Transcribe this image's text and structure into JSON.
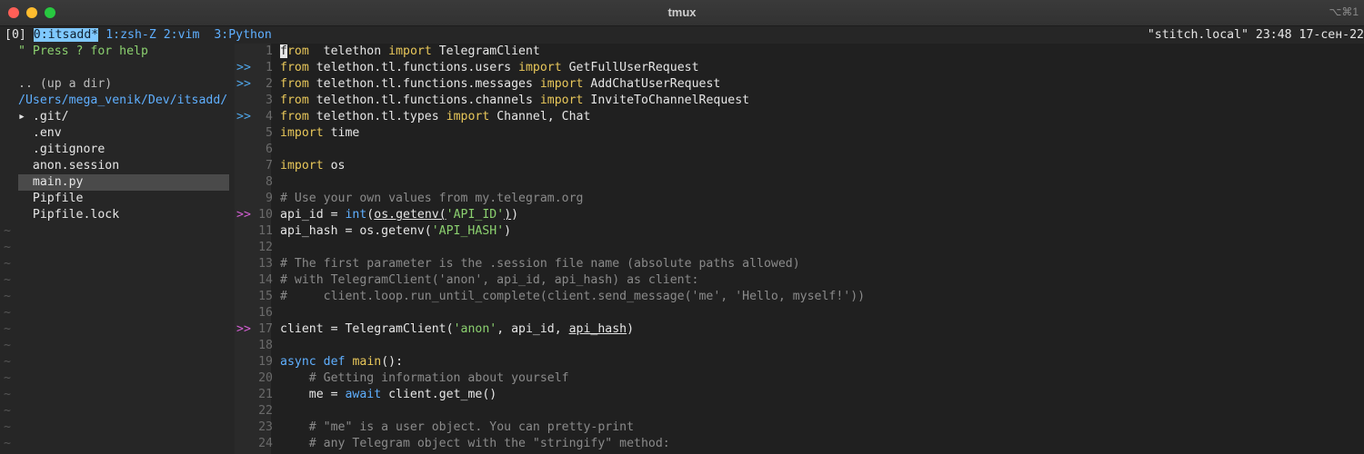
{
  "window": {
    "title": "tmux",
    "shortcut": "⌥⌘1"
  },
  "tmux": {
    "session_index": "[0]",
    "windows": [
      {
        "label": "0:itsadd*",
        "active": true
      },
      {
        "label": "1:zsh-Z",
        "active": false
      },
      {
        "label": "2:vim",
        "active": false
      },
      {
        "label": "3:Python",
        "active": false
      }
    ],
    "status_right": "\"stitch.local\" 23:48 17-сен-22"
  },
  "sidebar": {
    "help": "\" Press ? for help",
    "up_dir": ".. (up a dir)",
    "path": "/Users/mega_venik/Dev/itsadd/",
    "items": [
      {
        "label": "▸ .git/",
        "selected": false
      },
      {
        "label": "  .env",
        "selected": false
      },
      {
        "label": "  .gitignore",
        "selected": false
      },
      {
        "label": "  anon.session",
        "selected": false
      },
      {
        "label": "  main.py",
        "selected": true
      },
      {
        "label": "  Pipfile",
        "selected": false
      },
      {
        "label": "  Pipfile.lock",
        "selected": false
      }
    ],
    "tilde": "~"
  },
  "editor": {
    "lines": [
      {
        "n": "1",
        "sign": "",
        "segs": [
          [
            "cursor",
            "f"
          ],
          [
            "k",
            "rom"
          ],
          [
            "",
            "  telethon "
          ],
          [
            "k",
            "import"
          ],
          [
            "",
            " TelegramClient"
          ]
        ]
      },
      {
        "n": "1",
        "sign": ">>",
        "segs": [
          [
            "k",
            "from"
          ],
          [
            "",
            " telethon.tl.functions.users "
          ],
          [
            "k",
            "import"
          ],
          [
            "",
            " GetFullUserRequest"
          ]
        ]
      },
      {
        "n": "2",
        "sign": ">>",
        "segs": [
          [
            "k",
            "from"
          ],
          [
            "",
            " telethon.tl.functions.messages "
          ],
          [
            "k",
            "import"
          ],
          [
            "",
            " AddChatUserRequest"
          ]
        ]
      },
      {
        "n": "3",
        "sign": "",
        "segs": [
          [
            "k",
            "from"
          ],
          [
            "",
            " telethon.tl.functions.channels "
          ],
          [
            "k",
            "import"
          ],
          [
            "",
            " InviteToChannelRequest"
          ]
        ]
      },
      {
        "n": "4",
        "sign": ">>",
        "segs": [
          [
            "k",
            "from"
          ],
          [
            "",
            " telethon.tl.types "
          ],
          [
            "k",
            "import"
          ],
          [
            "",
            " Channel, Chat"
          ]
        ]
      },
      {
        "n": "5",
        "sign": "",
        "segs": [
          [
            "k",
            "import"
          ],
          [
            "",
            " time"
          ]
        ]
      },
      {
        "n": "6",
        "sign": "",
        "segs": []
      },
      {
        "n": "7",
        "sign": "",
        "segs": [
          [
            "k",
            "import"
          ],
          [
            "",
            " os"
          ]
        ]
      },
      {
        "n": "8",
        "sign": "",
        "segs": []
      },
      {
        "n": "9",
        "sign": "",
        "segs": [
          [
            "c",
            "# Use your own values from my.telegram.org"
          ]
        ]
      },
      {
        "n": "10",
        "sign": ">>w",
        "segs": [
          [
            "",
            "api_id = "
          ],
          [
            "b",
            "int"
          ],
          [
            "",
            "("
          ],
          [
            "u",
            "os.getenv("
          ],
          [
            "s",
            "'API_ID'"
          ],
          [
            "u",
            ")"
          ],
          [
            ")",
            ")"
          ]
        ]
      },
      {
        "n": "11",
        "sign": "",
        "segs": [
          [
            "",
            "api_hash = os.getenv("
          ],
          [
            "s",
            "'API_HASH'"
          ],
          [
            "",
            ")"
          ]
        ]
      },
      {
        "n": "12",
        "sign": "",
        "segs": []
      },
      {
        "n": "13",
        "sign": "",
        "segs": [
          [
            "c",
            "# The first parameter is the .session file name (absolute paths allowed)"
          ]
        ]
      },
      {
        "n": "14",
        "sign": "",
        "segs": [
          [
            "c",
            "# with TelegramClient('anon', api_id, api_hash) as client:"
          ]
        ]
      },
      {
        "n": "15",
        "sign": "",
        "segs": [
          [
            "c",
            "#     client.loop.run_until_complete(client.send_message('me', 'Hello, myself!'))"
          ]
        ]
      },
      {
        "n": "16",
        "sign": "",
        "segs": []
      },
      {
        "n": "17",
        "sign": ">>w",
        "segs": [
          [
            "",
            "client = TelegramClient("
          ],
          [
            "s",
            "'anon'"
          ],
          [
            "",
            ", api_id, "
          ],
          [
            "u",
            "api_hash"
          ],
          [
            "",
            ")"
          ]
        ]
      },
      {
        "n": "18",
        "sign": "",
        "segs": []
      },
      {
        "n": "19",
        "sign": "",
        "segs": [
          [
            "b",
            "async"
          ],
          [
            "",
            " "
          ],
          [
            "b",
            "def"
          ],
          [
            "",
            " "
          ],
          [
            "k",
            "main"
          ],
          [
            "",
            "():"
          ]
        ]
      },
      {
        "n": "20",
        "sign": "",
        "segs": [
          [
            "",
            "    "
          ],
          [
            "c",
            "# Getting information about yourself"
          ]
        ]
      },
      {
        "n": "21",
        "sign": "",
        "segs": [
          [
            "",
            "    me = "
          ],
          [
            "b",
            "await"
          ],
          [
            "",
            " client.get_me()"
          ]
        ]
      },
      {
        "n": "22",
        "sign": "",
        "segs": []
      },
      {
        "n": "23",
        "sign": "",
        "segs": [
          [
            "",
            "    "
          ],
          [
            "c",
            "# \"me\" is a user object. You can pretty-print"
          ]
        ]
      },
      {
        "n": "24",
        "sign": "",
        "segs": [
          [
            "",
            "    "
          ],
          [
            "c",
            "# any Telegram object with the \"stringify\" method:"
          ]
        ]
      }
    ]
  }
}
